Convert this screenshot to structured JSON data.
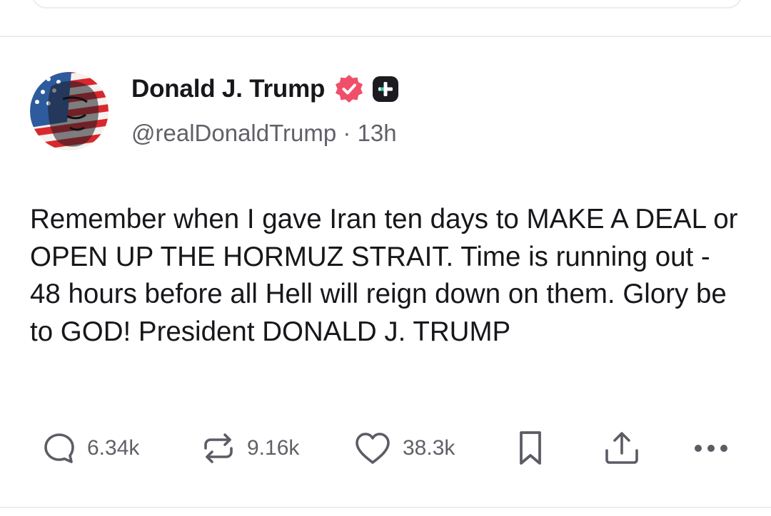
{
  "post": {
    "author": {
      "display_name": "Donald J. Trump",
      "handle": "@realDonaldTrump",
      "time_ago": "13h",
      "separator": "·"
    },
    "text": "Remember when I gave Iran ten days to MAKE A DEAL or OPEN UP THE HORMUZ STRAIT. Time is running out - 48 hours before all Hell will reign down on them. Glory be to GOD! President DONALD J. TRUMP",
    "stats": {
      "replies": "6.34k",
      "reposts": "9.16k",
      "likes": "38.3k"
    }
  },
  "icons": {
    "verified": "verified-badge-icon",
    "plus": "plus-badge-icon",
    "reply": "reply-icon",
    "repost": "repost-icon",
    "like": "heart-icon",
    "bookmark": "bookmark-icon",
    "share": "share-icon",
    "more": "more-icon"
  },
  "colors": {
    "text_primary": "#17171b",
    "text_secondary": "#606068",
    "verified_badge": "#f04f6a",
    "divider": "#ececf0"
  }
}
